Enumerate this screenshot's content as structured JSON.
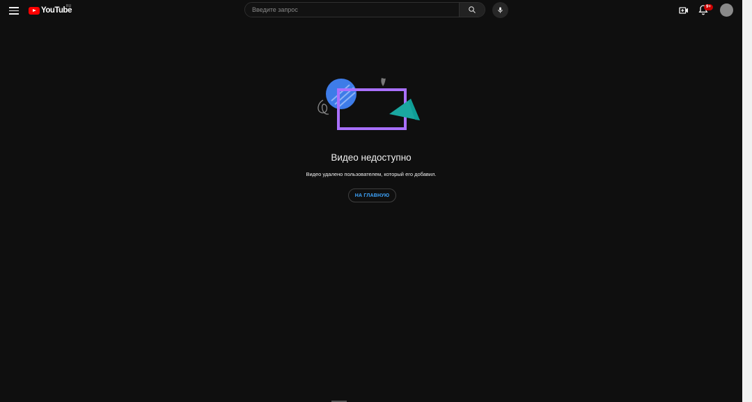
{
  "header": {
    "logo_text": "YouTube",
    "logo_country": "RU",
    "search_placeholder": "Введите запрос",
    "notifications_badge": "9+"
  },
  "main": {
    "title": "Видео недоступно",
    "message": "Видео удалено пользователем, который его добавил.",
    "home_button_label": "НА ГЛАВНУЮ"
  },
  "icons": {
    "menu": "hamburger-menu-icon",
    "search": "search-icon",
    "mic": "microphone-icon",
    "create": "create-video-icon",
    "bell": "bell-icon"
  },
  "colors": {
    "background": "#0f0f0f",
    "brand_red": "#ff0000",
    "link_blue": "#3ea6ff",
    "badge_red": "#cc0000",
    "illustration_blue": "#3e7ce8",
    "illustration_purple": "#a970ff",
    "illustration_teal": "#1aa7a0"
  }
}
